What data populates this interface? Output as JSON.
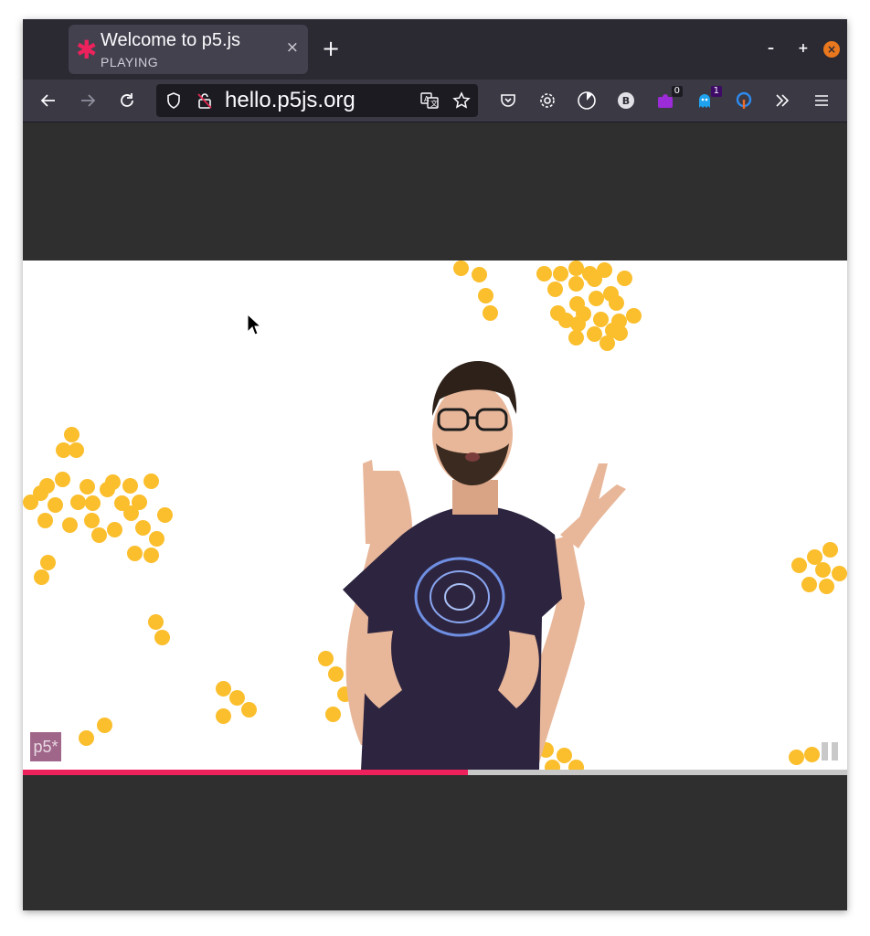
{
  "tab": {
    "title": "Welcome to p5.js",
    "status": "PLAYING",
    "close": "×",
    "favicon_color": "#ed225d"
  },
  "newtab_label": "+",
  "window_controls": {
    "minimize": "–",
    "maximize": "+",
    "close": "×"
  },
  "url": "hello.p5js.org",
  "toolbar_icons": [
    "back-icon",
    "forward-icon",
    "reload-icon",
    "shield-icon",
    "insecure-lock-icon",
    "translate-icon",
    "bookmark-star-icon",
    "pocket-icon",
    "gear-icon",
    "timer-icon",
    "b-extension-icon",
    "purple-extension-icon",
    "ghost-extension-icon",
    "bulb-extension-icon",
    "overflow-chevron-icon",
    "menu-icon"
  ],
  "extension_badges": {
    "purple": "0",
    "ghost": "1"
  },
  "extension_b_label": "B",
  "p5_logo_text": "p5*",
  "progress": 0.54,
  "colors": {
    "accent": "#ed225d",
    "dot": "#fbbe2c",
    "chrome": "#2b2a33"
  }
}
